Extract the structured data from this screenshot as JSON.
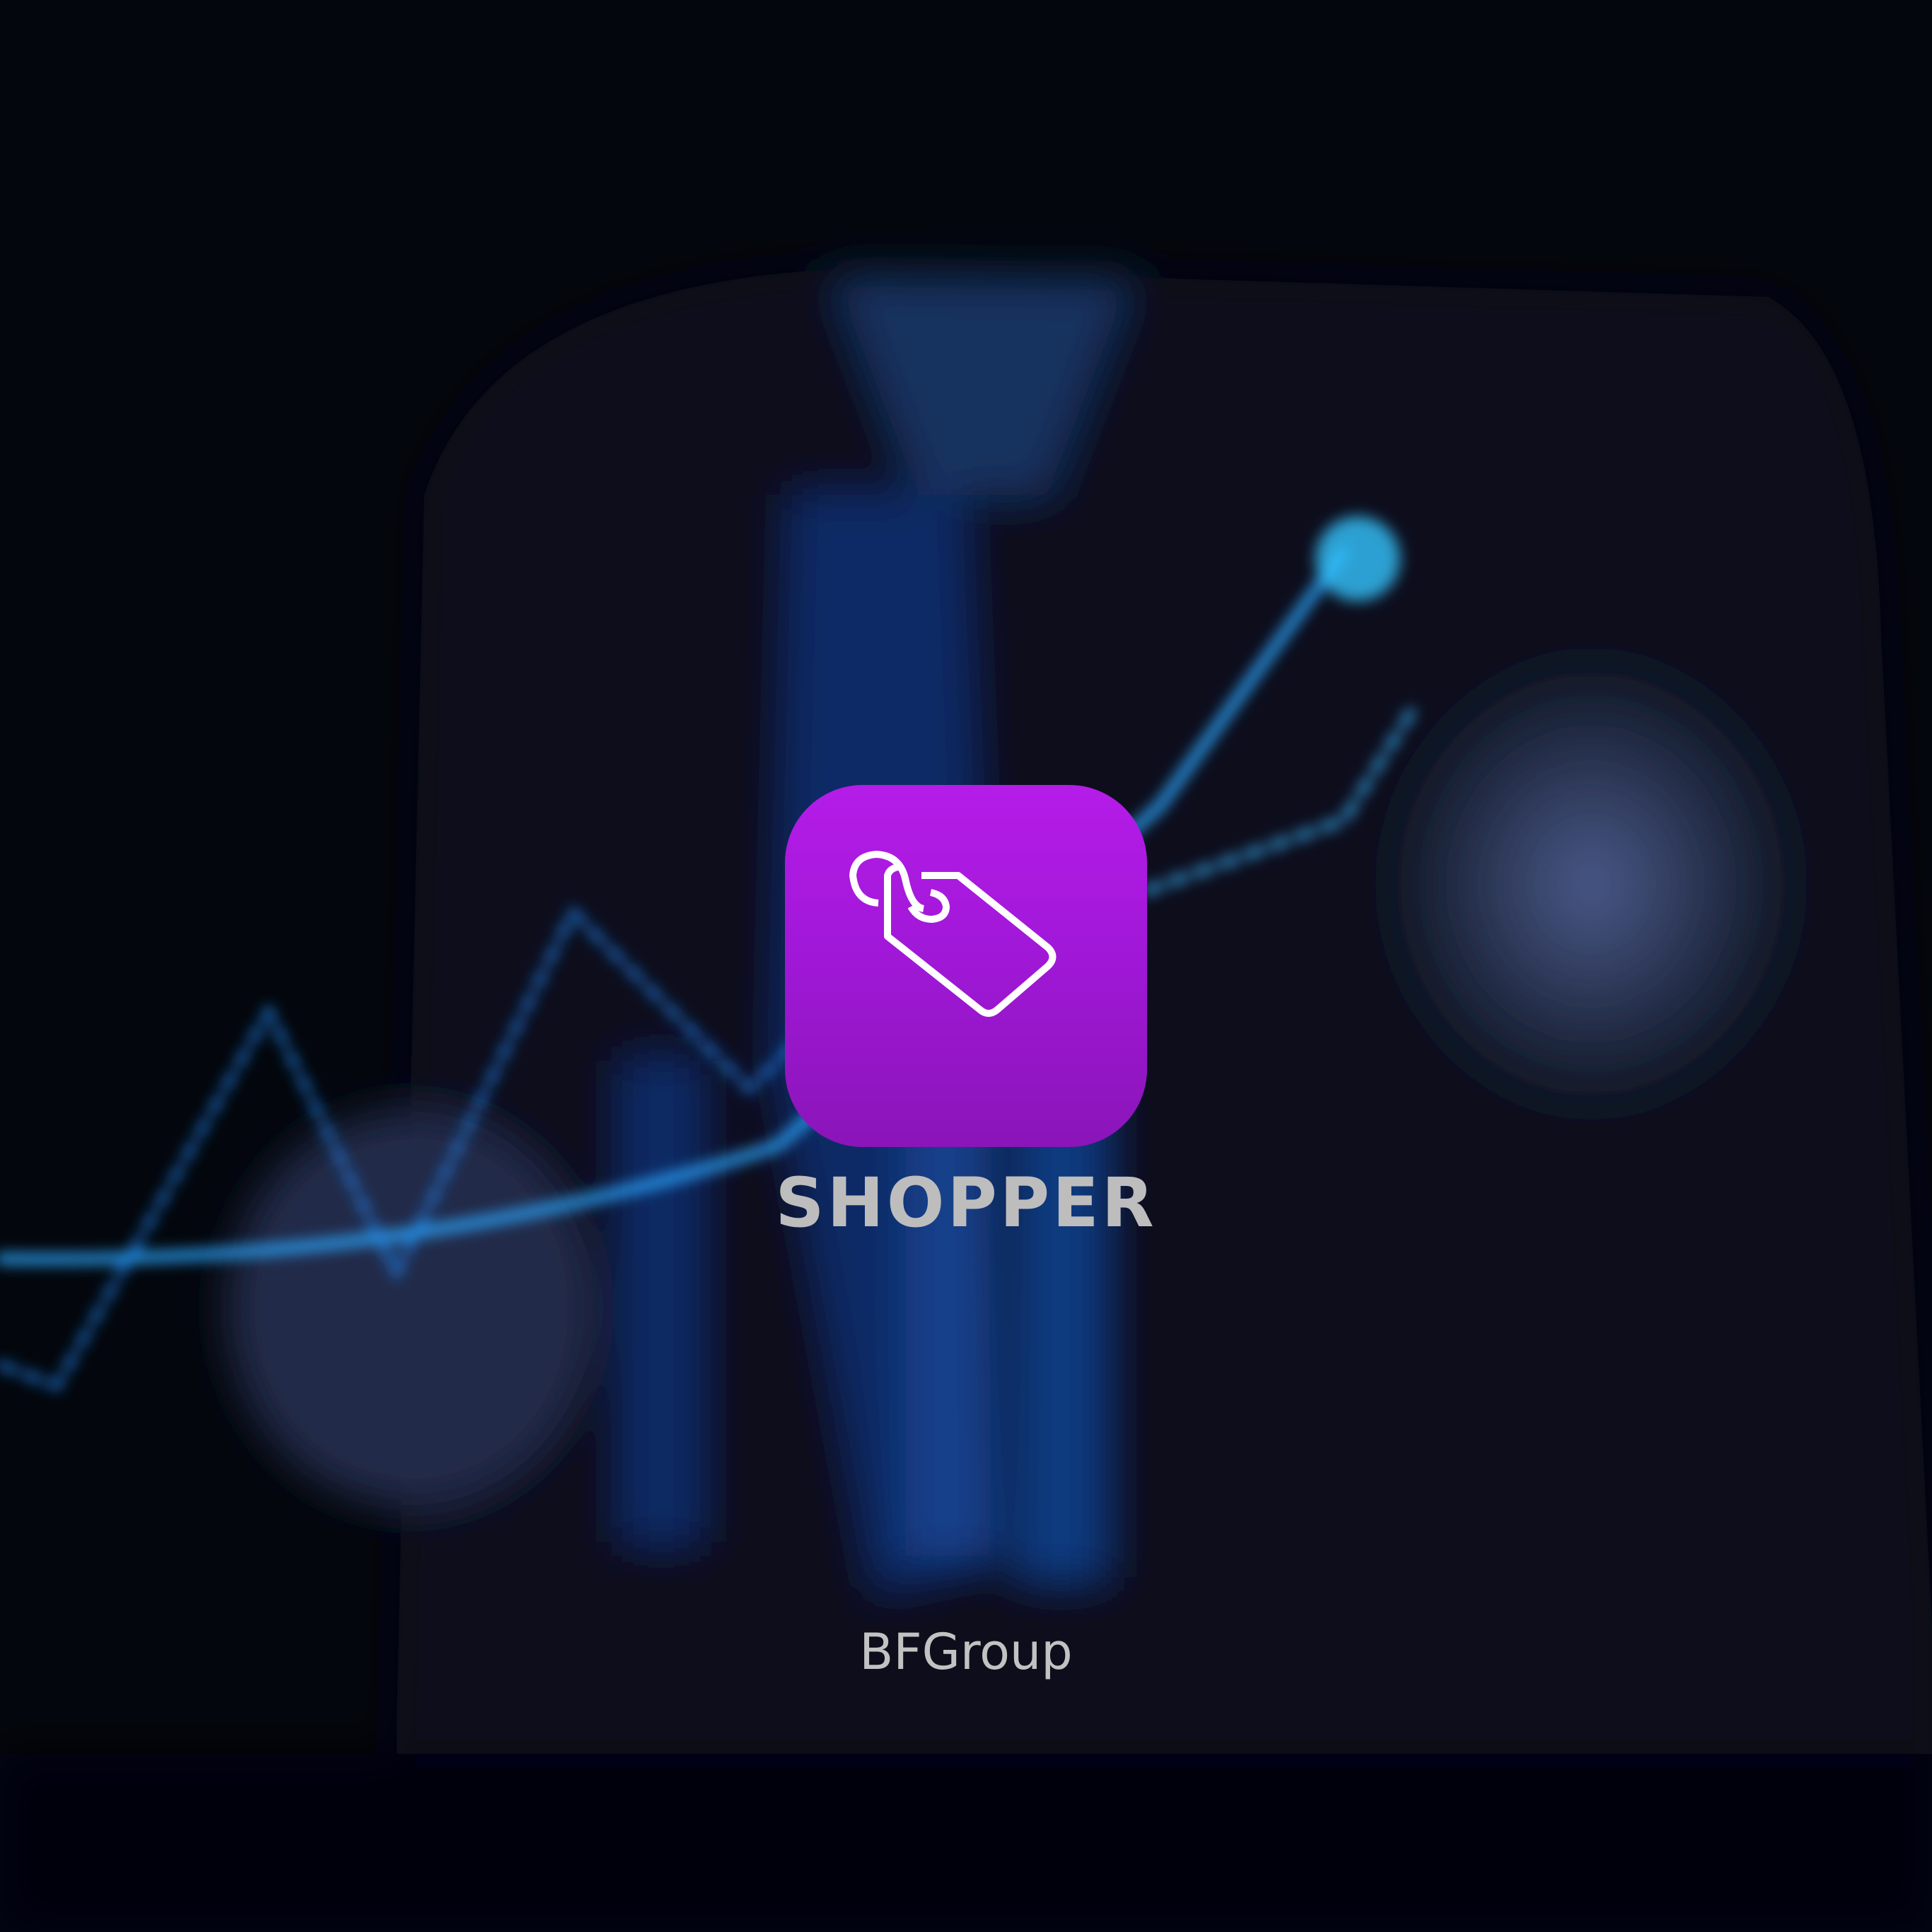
{
  "splash": {
    "app_name": "SHOPPER",
    "publisher": "BFGroup",
    "icon": "price-tag-icon",
    "accent_color": "#b51ce8",
    "text_color": "#bdbdbd",
    "background_color": "#03060c"
  }
}
